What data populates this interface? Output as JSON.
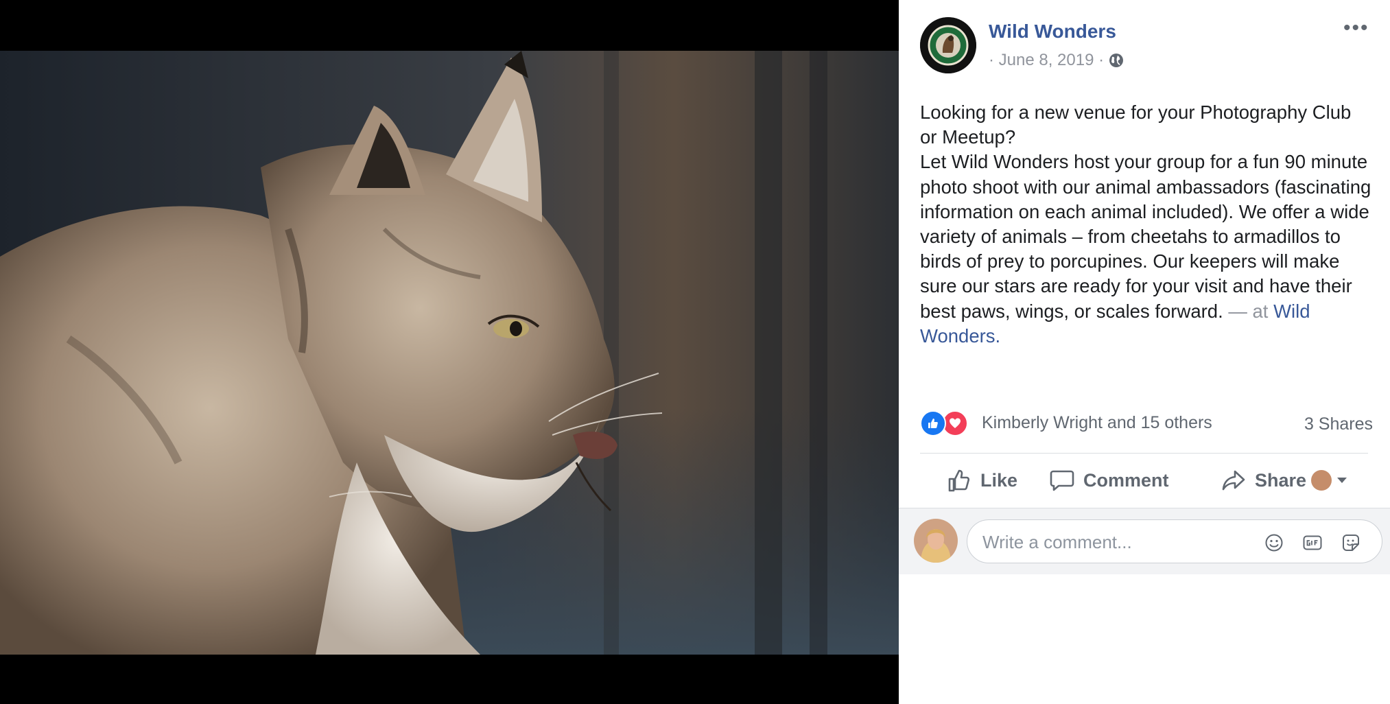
{
  "photo": {
    "subject": "lynx-photo"
  },
  "post": {
    "page_name": "Wild Wonders",
    "date": "· June 8, 2019 ·",
    "privacy_icon": "globe-icon",
    "more_label": "•••",
    "text_lines": [
      "Looking for a new venue for your Photography Club or Meetup?",
      "Let Wild Wonders host your group for a fun 90 minute photo shoot with our animal ambassadors (fascinating information on each animal included). We offer a wide variety of animals – from cheetahs to armadillos to birds of prey to porcupines. Our keepers will make sure our stars are ready for your visit and have their best paws, wings, or scales forward."
    ],
    "at_prefix": "— at",
    "at_place": "Wild Wonders."
  },
  "reactions": {
    "icons": [
      "like-reaction-icon",
      "love-reaction-icon"
    ],
    "names": "Kimberly Wright and 15 others",
    "shares": "3 Shares"
  },
  "actions": {
    "like": "Like",
    "comment": "Comment",
    "share": "Share"
  },
  "comment_box": {
    "placeholder": "Write a comment..."
  },
  "colors": {
    "link": "#385898",
    "like_blue": "#1877f2",
    "love_red": "#f33e58",
    "muted": "#606770",
    "panel_gray": "#f2f3f5"
  }
}
